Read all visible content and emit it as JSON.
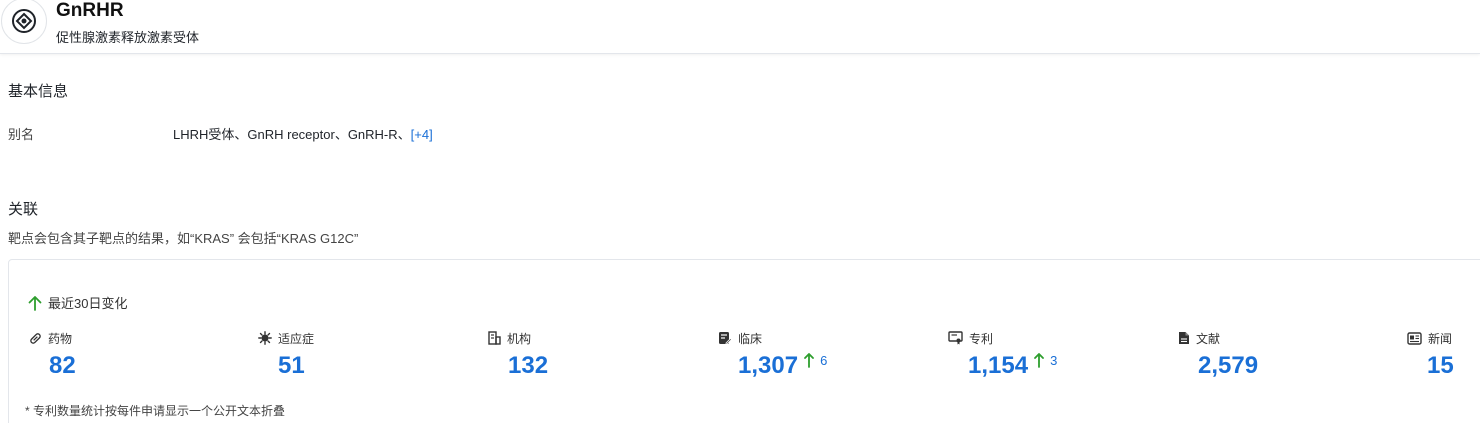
{
  "header": {
    "title": "GnRHR",
    "subtitle": "促性腺激素释放激素受体"
  },
  "basic_info": {
    "section_title": "基本信息",
    "alias_label": "别名",
    "alias_value": "LHRH受体、GnRH receptor、GnRH-R、",
    "alias_more": "[+4]"
  },
  "related": {
    "section_title": "关联",
    "description": "靶点会包含其子靶点的结果，如“KRAS” 会包括“KRAS G12C”",
    "change_label": "最近30日变化",
    "stats": [
      {
        "label": "药物",
        "icon": "pill-icon",
        "value": "82",
        "delta": ""
      },
      {
        "label": "适应症",
        "icon": "virus-icon",
        "value": "51",
        "delta": ""
      },
      {
        "label": "机构",
        "icon": "building-icon",
        "value": "132",
        "delta": ""
      },
      {
        "label": "临床",
        "icon": "clipboard-edit-icon",
        "value": "1,307",
        "delta": "6"
      },
      {
        "label": "专利",
        "icon": "certificate-icon",
        "value": "1,154",
        "delta": "3"
      },
      {
        "label": "文献",
        "icon": "document-icon",
        "value": "2,579",
        "delta": ""
      },
      {
        "label": "新闻",
        "icon": "newspaper-icon",
        "value": "15",
        "delta": ""
      }
    ],
    "footnote": "* 专利数量统计按每件申请显示一个公开文本折叠"
  },
  "colors": {
    "accent": "#1a6fd6",
    "increase": "#2e9e2e"
  }
}
